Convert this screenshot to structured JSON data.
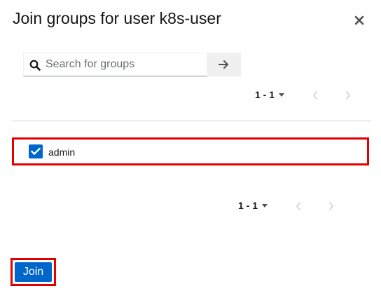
{
  "dialog": {
    "title": "Join groups for user k8s-user",
    "close_icon": "close-icon"
  },
  "search": {
    "placeholder": "Search for groups",
    "value": "",
    "icon": "search-icon",
    "submit_icon": "arrow-right-icon"
  },
  "pagination_top": {
    "range": "1 - 1",
    "prev_icon": "chevron-left-icon",
    "next_icon": "chevron-right-icon",
    "prev_enabled": false,
    "next_enabled": false
  },
  "groups": [
    {
      "name": "admin",
      "checked": true
    }
  ],
  "pagination_bottom": {
    "range": "1 - 1",
    "prev_icon": "chevron-left-icon",
    "next_icon": "chevron-right-icon",
    "prev_enabled": false,
    "next_enabled": false
  },
  "footer": {
    "join_label": "Join"
  },
  "colors": {
    "primary": "#0066cc",
    "highlight_border": "#e00000",
    "disabled_icon": "#d2d2d2"
  }
}
